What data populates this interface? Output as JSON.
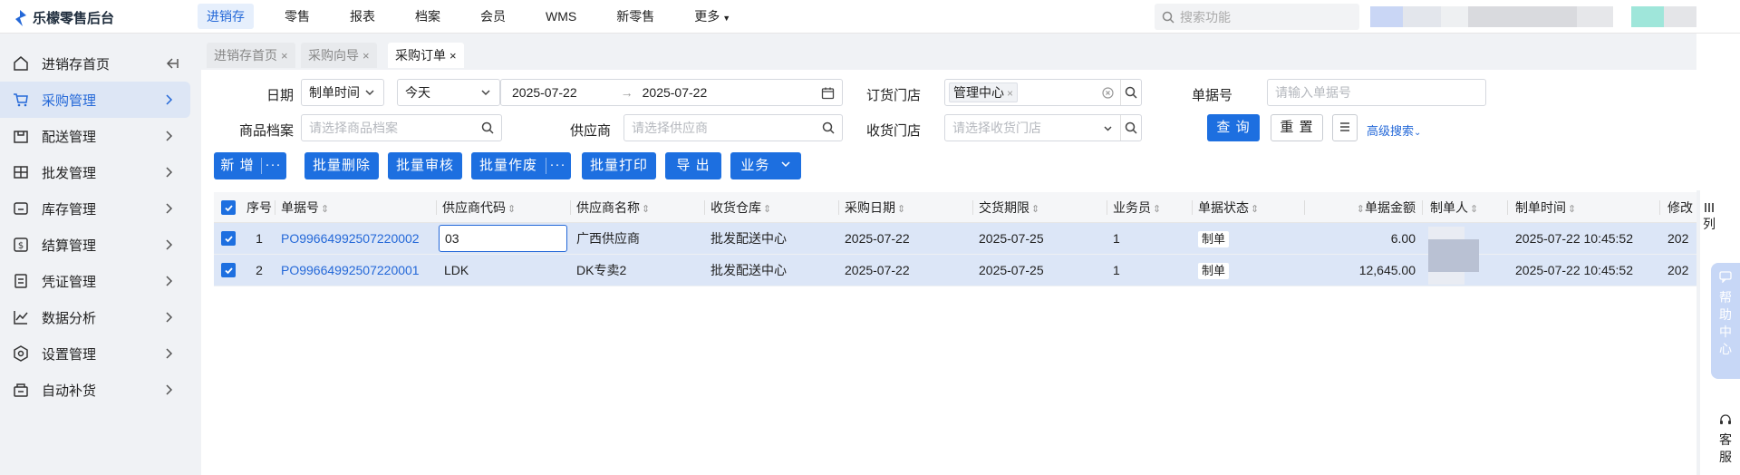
{
  "app": {
    "title": "乐檬零售后台"
  },
  "nav": [
    {
      "label": "进销存",
      "active": true
    },
    {
      "label": "零售"
    },
    {
      "label": "报表"
    },
    {
      "label": "档案"
    },
    {
      "label": "会员"
    },
    {
      "label": "WMS"
    },
    {
      "label": "新零售"
    },
    {
      "label": "更多"
    }
  ],
  "search": {
    "placeholder": "搜索功能"
  },
  "sidebar": {
    "items": [
      {
        "label": "进销存首页",
        "icon": "home-icon"
      },
      {
        "label": "采购管理",
        "icon": "cart-icon",
        "active": true
      },
      {
        "label": "配送管理",
        "icon": "box-icon"
      },
      {
        "label": "批发管理",
        "icon": "wholesale-icon"
      },
      {
        "label": "库存管理",
        "icon": "inventory-icon"
      },
      {
        "label": "结算管理",
        "icon": "settlement-icon"
      },
      {
        "label": "凭证管理",
        "icon": "voucher-icon"
      },
      {
        "label": "数据分析",
        "icon": "chart-icon"
      },
      {
        "label": "设置管理",
        "icon": "settings-icon"
      },
      {
        "label": "自动补货",
        "icon": "replenish-icon"
      }
    ]
  },
  "tabs": [
    {
      "label": "进销存首页"
    },
    {
      "label": "采购向导"
    },
    {
      "label": "采购订单",
      "active": true
    }
  ],
  "filters": {
    "date_label": "日期",
    "date_type": "制单时间",
    "date_range": "今天",
    "date_start": "2025-07-22",
    "date_end": "2025-07-22",
    "store_label": "订货门店",
    "store_chip": "管理中心",
    "order_no_label": "单据号",
    "order_no_placeholder": "请输入单据号",
    "product_label": "商品档案",
    "product_placeholder": "请选择商品档案",
    "supplier_label": "供应商",
    "supplier_placeholder": "请选择供应商",
    "recv_store_label": "收货门店",
    "recv_store_placeholder": "请选择收货门店",
    "query": "查 询",
    "reset": "重 置",
    "advanced": "高级搜索"
  },
  "actions": {
    "add": "新 增",
    "batch_delete": "批量删除",
    "batch_review": "批量审核",
    "batch_void": "批量作废",
    "batch_print": "批量打印",
    "export": "导 出",
    "business": "业务"
  },
  "table": {
    "headers": {
      "seq": "序号",
      "order_no": "单据号",
      "supplier_code": "供应商代码",
      "supplier_name": "供应商名称",
      "warehouse": "收货仓库",
      "purchase_date": "采购日期",
      "delivery_date": "交货期限",
      "salesman": "业务员",
      "status": "单据状态",
      "amount": "单据金额",
      "creator": "制单人",
      "created_at": "制单时间",
      "modified": "修改"
    },
    "rows": [
      {
        "seq": "1",
        "order_no": "PO99664992507220002",
        "supplier_code": "03",
        "supplier_name": "广西供应商",
        "warehouse": "批发配送中心",
        "purchase_date": "2025-07-22",
        "delivery_date": "2025-07-25",
        "salesman": "1",
        "status": "制单",
        "amount": "6.00",
        "created_at": "2025-07-22 10:45:52",
        "modified": "202"
      },
      {
        "seq": "2",
        "order_no": "PO99664992507220001",
        "supplier_code": "LDK",
        "supplier_name": "DK专卖2",
        "warehouse": "批发配送中心",
        "purchase_date": "2025-07-22",
        "delivery_date": "2025-07-25",
        "salesman": "1",
        "status": "制单",
        "amount": "12,645.00",
        "created_at": "2025-07-22 10:45:52",
        "modified": "202"
      }
    ]
  },
  "rail": {
    "columns_label": "列",
    "help": "帮助中心",
    "service": "客服"
  },
  "colors": {
    "primary": "#1d6fe0",
    "row_selected": "#dce6f7",
    "sidebar_active": "#dde6f5"
  }
}
